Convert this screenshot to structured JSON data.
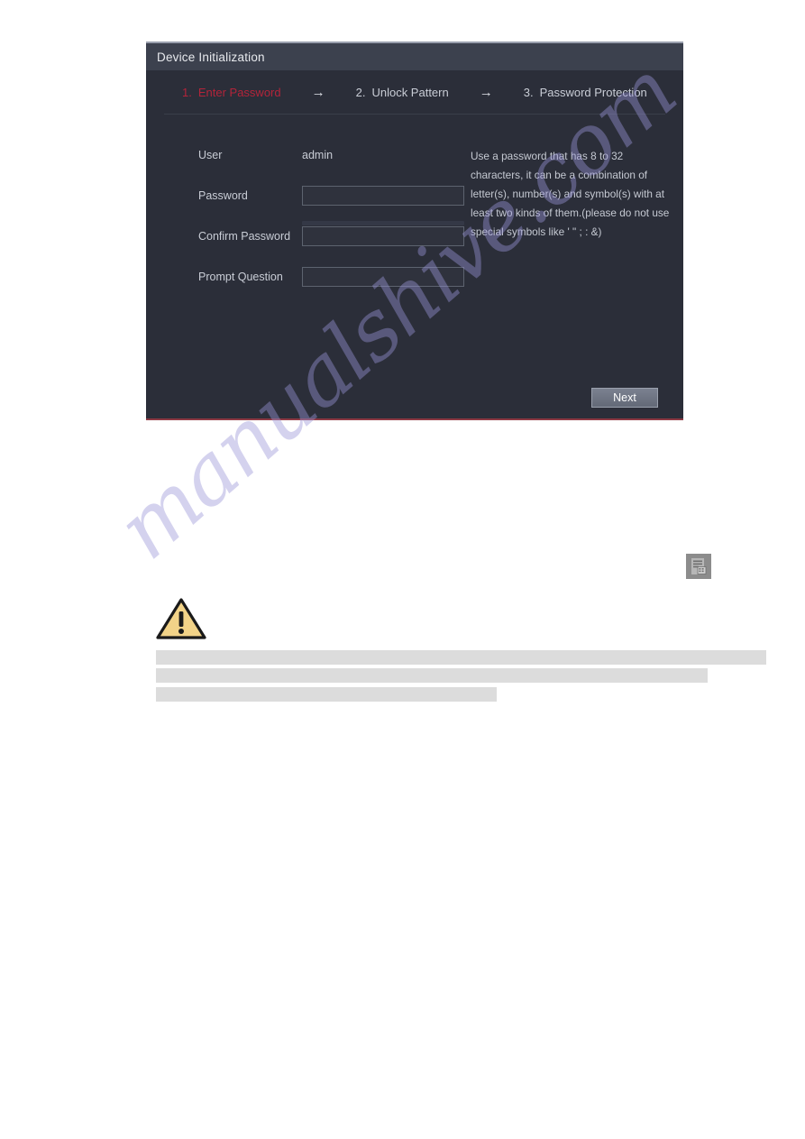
{
  "dialog": {
    "title": "Device Initialization",
    "steps": [
      {
        "num": "1.",
        "label": "Enter Password",
        "state": "active"
      },
      {
        "num": "2.",
        "label": "Unlock Pattern",
        "state": "inactive"
      },
      {
        "num": "3.",
        "label": "Password Protection",
        "state": "inactive"
      }
    ],
    "arrow_glyph": "→",
    "form": {
      "user_label": "User",
      "user_value": "admin",
      "password_label": "Password",
      "password_value": "",
      "password_placeholder": "",
      "confirm_label": "Confirm Password",
      "confirm_value": "",
      "confirm_placeholder": "",
      "prompt_label": "Prompt Question",
      "prompt_value": "",
      "prompt_placeholder": ""
    },
    "help_text": "Use a password that has 8 to 32 characters, it can be a combination of letter(s), number(s) and symbol(s) with at least two kinds of them.(please do not use special symbols like ' \" ; : &)",
    "next_label": "Next"
  },
  "page": {
    "watermark": "manualshive.com",
    "device_icon_name": "device-config-icon",
    "warning_icon_name": "warning-triangle-icon"
  },
  "colors": {
    "dialog_bg": "#2b2e39",
    "title_bar": "#3c414e",
    "active_step": "#b3243a",
    "inactive_step": "#c9cdd6",
    "input_border": "#5d636f",
    "button_text": "#ffffff",
    "warning_fill": "#f2d388",
    "redaction": "#dcdcdc",
    "watermark": "#9a96d8"
  }
}
